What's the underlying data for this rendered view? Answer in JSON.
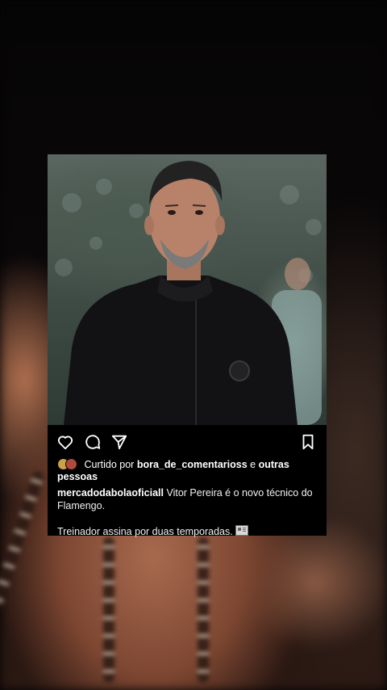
{
  "post": {
    "liked_by": {
      "prefix": "Curtido por",
      "user": "bora_de_comentarioss",
      "conjunction": "e",
      "others": "outras pessoas"
    },
    "caption": {
      "username": "mercadodabolaoficiall",
      "text": "Vitor Pereira é o novo técnico do Flamengo.",
      "second_line": "Treinador assina por duas temporadas."
    },
    "icons": [
      "heart-icon",
      "comment-icon",
      "share-icon",
      "bookmark-icon"
    ]
  },
  "colors": {
    "post_background": "#000000",
    "text": "#ffffff"
  }
}
